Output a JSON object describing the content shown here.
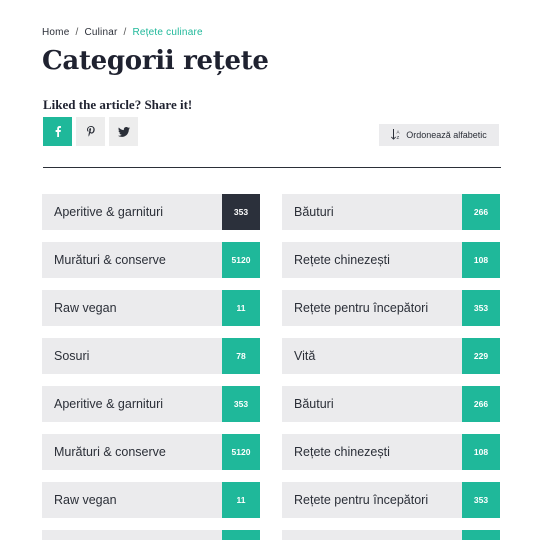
{
  "breadcrumb": {
    "home": "Home",
    "sep1": "/",
    "section": "Culinar",
    "sep2": "/",
    "current": "Rețete culinare"
  },
  "title": "Categorii rețete",
  "share": {
    "label": "Liked the article? Share it!",
    "buttons": [
      "facebook-icon",
      "pinterest-icon",
      "twitter-icon"
    ]
  },
  "sort": {
    "label": "Ordonează alfabetic",
    "icon": "sort-alpha-icon"
  },
  "colors": {
    "accent": "#1fb89a",
    "dark": "#2b303b",
    "tile": "#ebebed",
    "text": "#2b2f38"
  },
  "categories": [
    {
      "label": "Aperitive & garnituri",
      "count": "353",
      "highlight": true
    },
    {
      "label": "Băuturi",
      "count": "266",
      "highlight": false
    },
    {
      "label": "Murături & conserve",
      "count": "5120",
      "highlight": false
    },
    {
      "label": "Rețete chinezești",
      "count": "108",
      "highlight": false
    },
    {
      "label": "Raw vegan",
      "count": "11",
      "highlight": false
    },
    {
      "label": "Rețete pentru începători",
      "count": "353",
      "highlight": false
    },
    {
      "label": "Sosuri",
      "count": "78",
      "highlight": false
    },
    {
      "label": "Vită",
      "count": "229",
      "highlight": false
    },
    {
      "label": "Aperitive & garnituri",
      "count": "353",
      "highlight": false
    },
    {
      "label": "Băuturi",
      "count": "266",
      "highlight": false
    },
    {
      "label": "Murături & conserve",
      "count": "5120",
      "highlight": false
    },
    {
      "label": "Rețete chinezești",
      "count": "108",
      "highlight": false
    },
    {
      "label": "Raw vegan",
      "count": "11",
      "highlight": false
    },
    {
      "label": "Rețete pentru începători",
      "count": "353",
      "highlight": false
    },
    {
      "label": "",
      "count": "",
      "highlight": false
    },
    {
      "label": "",
      "count": "",
      "highlight": false
    }
  ]
}
